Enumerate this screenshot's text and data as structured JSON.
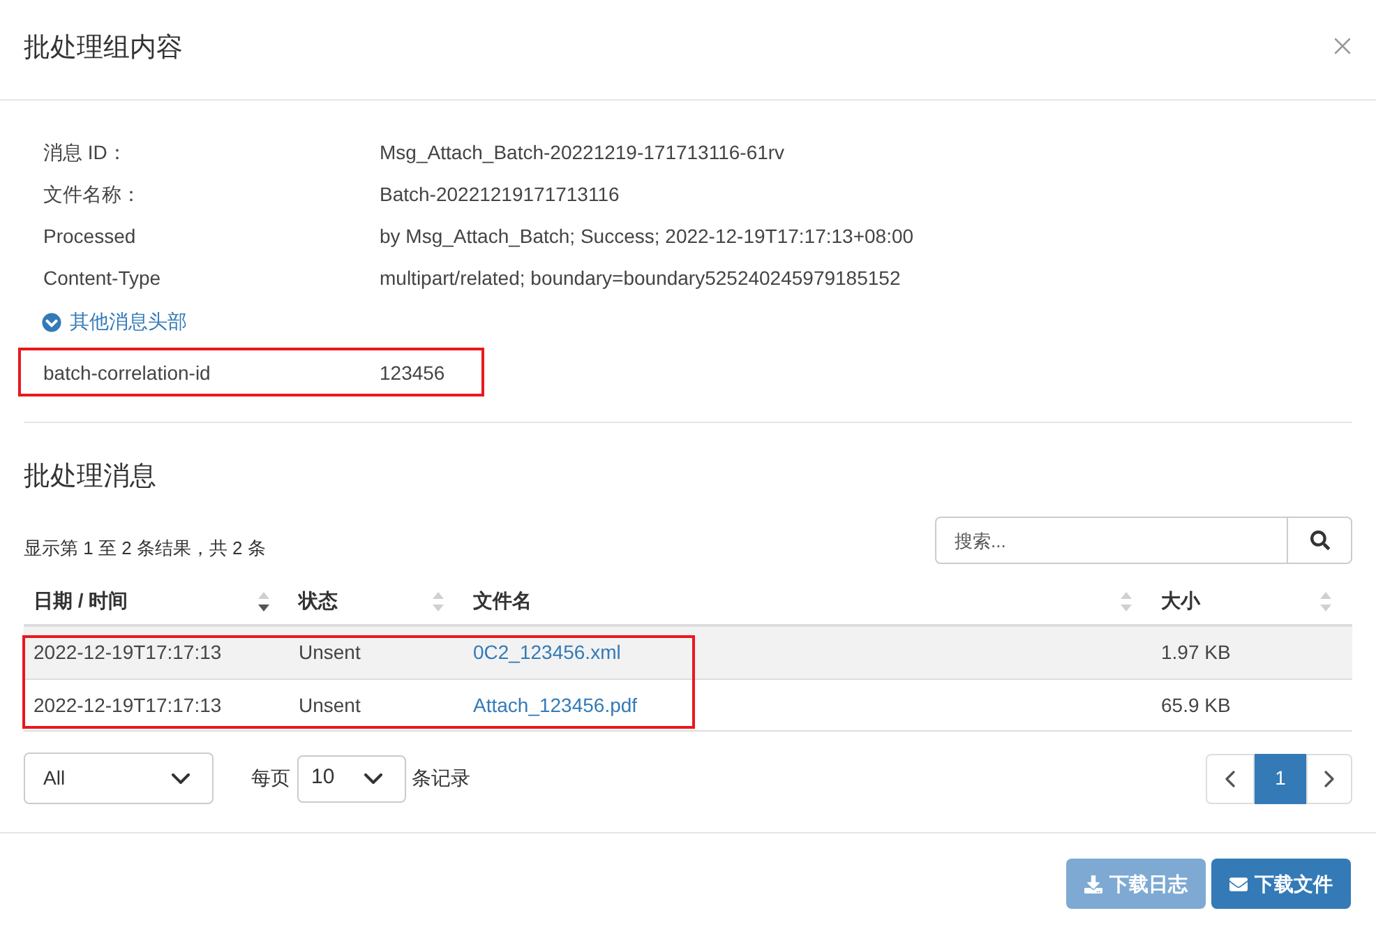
{
  "dialog": {
    "title": "批处理组内容"
  },
  "details": [
    {
      "label": "消息 ID：",
      "value": "Msg_Attach_Batch-20221219-171713116-61rv"
    },
    {
      "label": "文件名称：",
      "value": "Batch-20221219171713116"
    },
    {
      "label": "Processed",
      "value": "by Msg_Attach_Batch; Success; 2022-12-19T17:17:13+08:00"
    },
    {
      "label": "Content-Type",
      "value": "multipart/related; boundary=boundary525240245979185152"
    }
  ],
  "headers_toggle": {
    "label": "其他消息头部",
    "expanded": true
  },
  "extra_headers": [
    {
      "label": "batch-correlation-id",
      "value": "123456",
      "highlighted": true
    }
  ],
  "section": {
    "title": "批处理消息"
  },
  "table": {
    "info": "显示第 1 至 2 条结果，共 2 条",
    "search": {
      "placeholder": "搜索..."
    },
    "columns": [
      {
        "label": "日期 / 时间",
        "sorted": true
      },
      {
        "label": "状态",
        "sorted": false
      },
      {
        "label": "文件名",
        "sorted": false
      },
      {
        "label": "大小",
        "sorted": false
      }
    ],
    "rows": [
      {
        "cells": [
          "2022-12-19T17:17:13",
          "Unsent",
          "0C2_123456.xml",
          "1.97 KB"
        ],
        "highlighted": true
      },
      {
        "cells": [
          "2022-12-19T17:17:13",
          "Unsent",
          "Attach_123456.pdf",
          "65.9 KB"
        ],
        "highlighted": true
      }
    ]
  },
  "filter": {
    "value": "All"
  },
  "page_size": {
    "prefix": "每页",
    "value": "10",
    "suffix": "条记录"
  },
  "pagination": {
    "pages": [
      {
        "label": "1",
        "selected": true
      }
    ]
  },
  "buttons": [
    {
      "label": "下载日志",
      "disabled": true
    },
    {
      "label": "下载文件",
      "disabled": false
    }
  ]
}
